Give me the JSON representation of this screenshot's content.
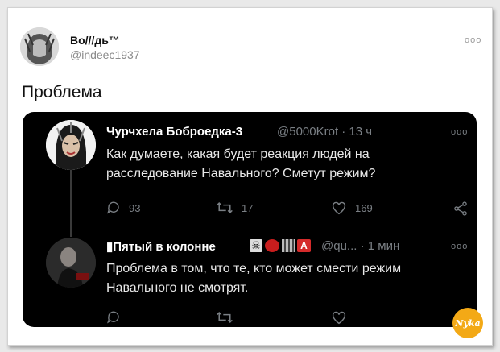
{
  "author": {
    "name": "Во///дь™",
    "handle": "@indeec1937"
  },
  "main_text": "Проблема",
  "tweet1": {
    "name": "Чурчхела Боброедка-3",
    "meta": "@5000Krot · 13 ч",
    "body": "Как думаете, какая будет реакция людей на расследование Навального? Сметут режим?",
    "replies": "93",
    "retweets": "17",
    "likes": "169"
  },
  "tweet2": {
    "name": "Пятый в колонне",
    "meta": "@qu... · 1 мин",
    "body": "Проблема в том, что те, кто может смести режим Навального не смотрят."
  },
  "more_dots": "ooo",
  "watermark_text": "Nyka",
  "colors": {
    "card_bg": "#000000",
    "icon_gray": "#7a7f84",
    "watermark": "#f3a916"
  }
}
